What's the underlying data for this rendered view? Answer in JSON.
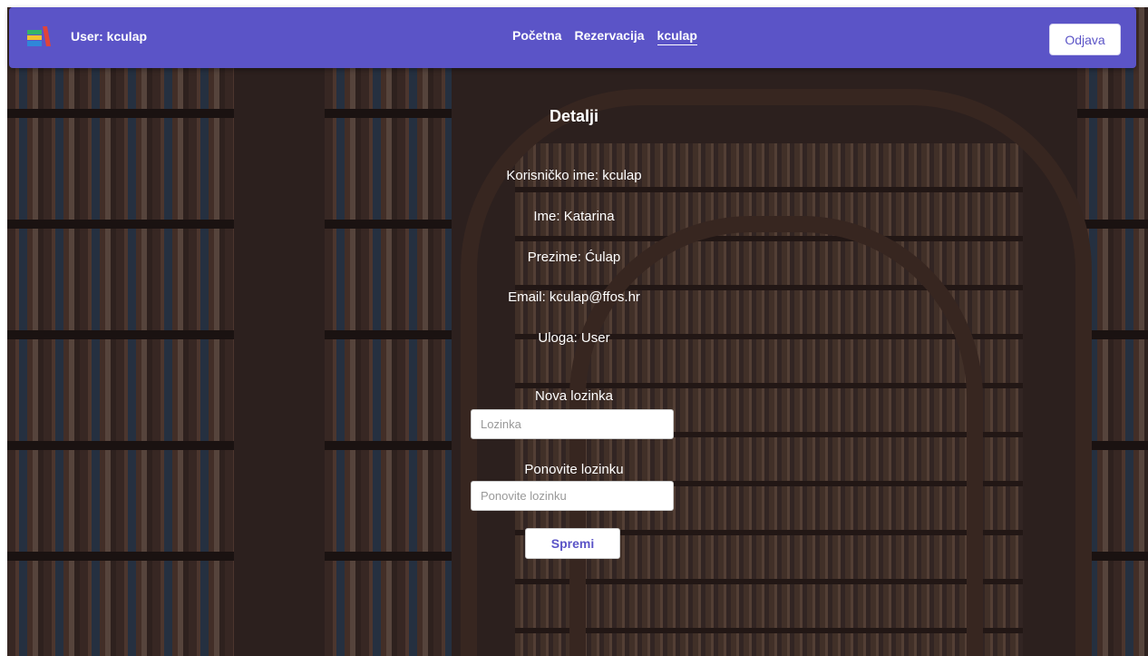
{
  "navbar": {
    "user_label": "User: kculap",
    "links": [
      {
        "label": "Početna"
      },
      {
        "label": "Rezervacija"
      },
      {
        "label": "kculap"
      }
    ],
    "logout_label": "Odjava"
  },
  "details": {
    "heading": "Detalji",
    "username": "Korisničko ime: kculap",
    "first_name": "Ime: Katarina",
    "last_name": "Prezime: Ćulap",
    "email": "Email: kculap@ffos.hr",
    "role": "Uloga: User"
  },
  "password_form": {
    "new_password_label": "Nova lozinka",
    "new_password_placeholder": "Lozinka",
    "repeat_password_label": "Ponovite lozinku",
    "repeat_password_placeholder": "Ponovite lozinku",
    "save_label": "Spremi"
  },
  "colors": {
    "navbar": "#5b54c7",
    "accent": "#5b54c7"
  },
  "icons": {
    "logo": "books-logo-icon"
  }
}
